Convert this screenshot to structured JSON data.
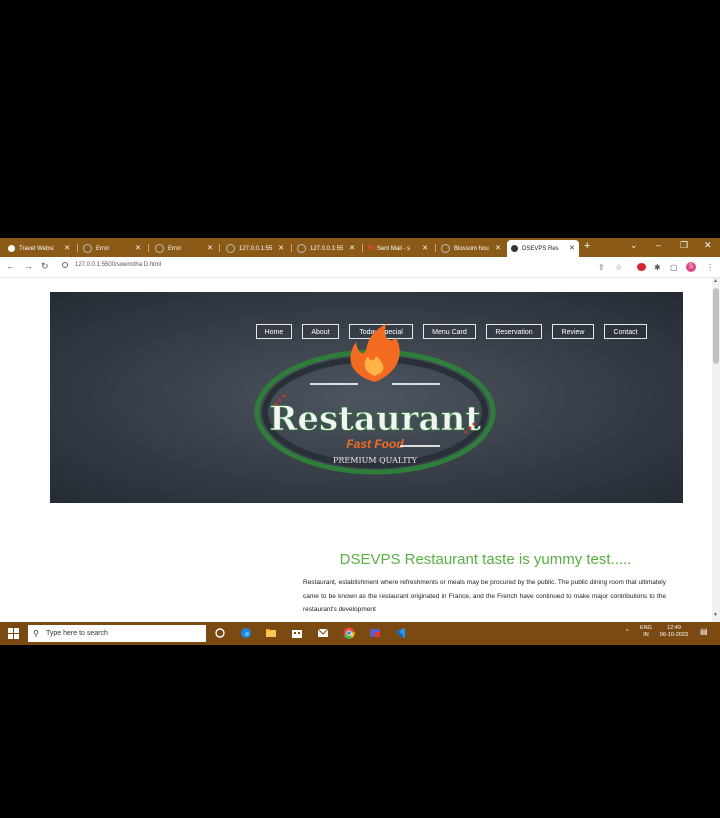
{
  "browser": {
    "tabs": [
      {
        "title": "Travel Websi",
        "active": false,
        "icon_color": "#ffffff"
      },
      {
        "title": "Error",
        "active": false,
        "icon_color": "#9e9e9e"
      },
      {
        "title": "Error",
        "active": false,
        "icon_color": "#9e9e9e"
      },
      {
        "title": "127.0.0.1:55",
        "active": false,
        "icon_color": "#9e9e9e"
      },
      {
        "title": "127.0.0.1:55",
        "active": false,
        "icon_color": "#9e9e9e"
      },
      {
        "title": "Sent Mail - s",
        "active": false,
        "icon_color": "#ea4335"
      },
      {
        "title": "Blossom hou",
        "active": false,
        "icon_color": "#9e9e9e"
      },
      {
        "title": "DSEVPS Res",
        "active": true,
        "icon_color": "#333333"
      }
    ],
    "new_tab_label": "+",
    "url": "127.0.0.1:5500/sowmitha D.html",
    "profile_initial": "S"
  },
  "site": {
    "nav": [
      "Home",
      "About",
      "Today Special",
      "Menu Card",
      "Reservation",
      "Review",
      "Contact"
    ],
    "logo": {
      "word": "Restaurant",
      "tagline": "Fast Food",
      "badge": "PREMIUM QUALITY"
    },
    "heading": "DSEVPS Restaurant taste is yummy test.....",
    "paragraph": "Restaurant, establishment where refreshments or meals may be procured by the public. The public dining room that ultimately came to be known as the restaurant originated in France, and the French have continued to make major contributions to the restaurant's development"
  },
  "taskbar": {
    "search_placeholder": "Type here to search",
    "lang": "ENG",
    "region": "IN",
    "time": "12:49",
    "date": "06-10-2023"
  },
  "colors": {
    "tabstrip": "#8a5a16",
    "taskbar": "#7a4a12",
    "heading": "#58b043",
    "hero": "#3a414b"
  }
}
